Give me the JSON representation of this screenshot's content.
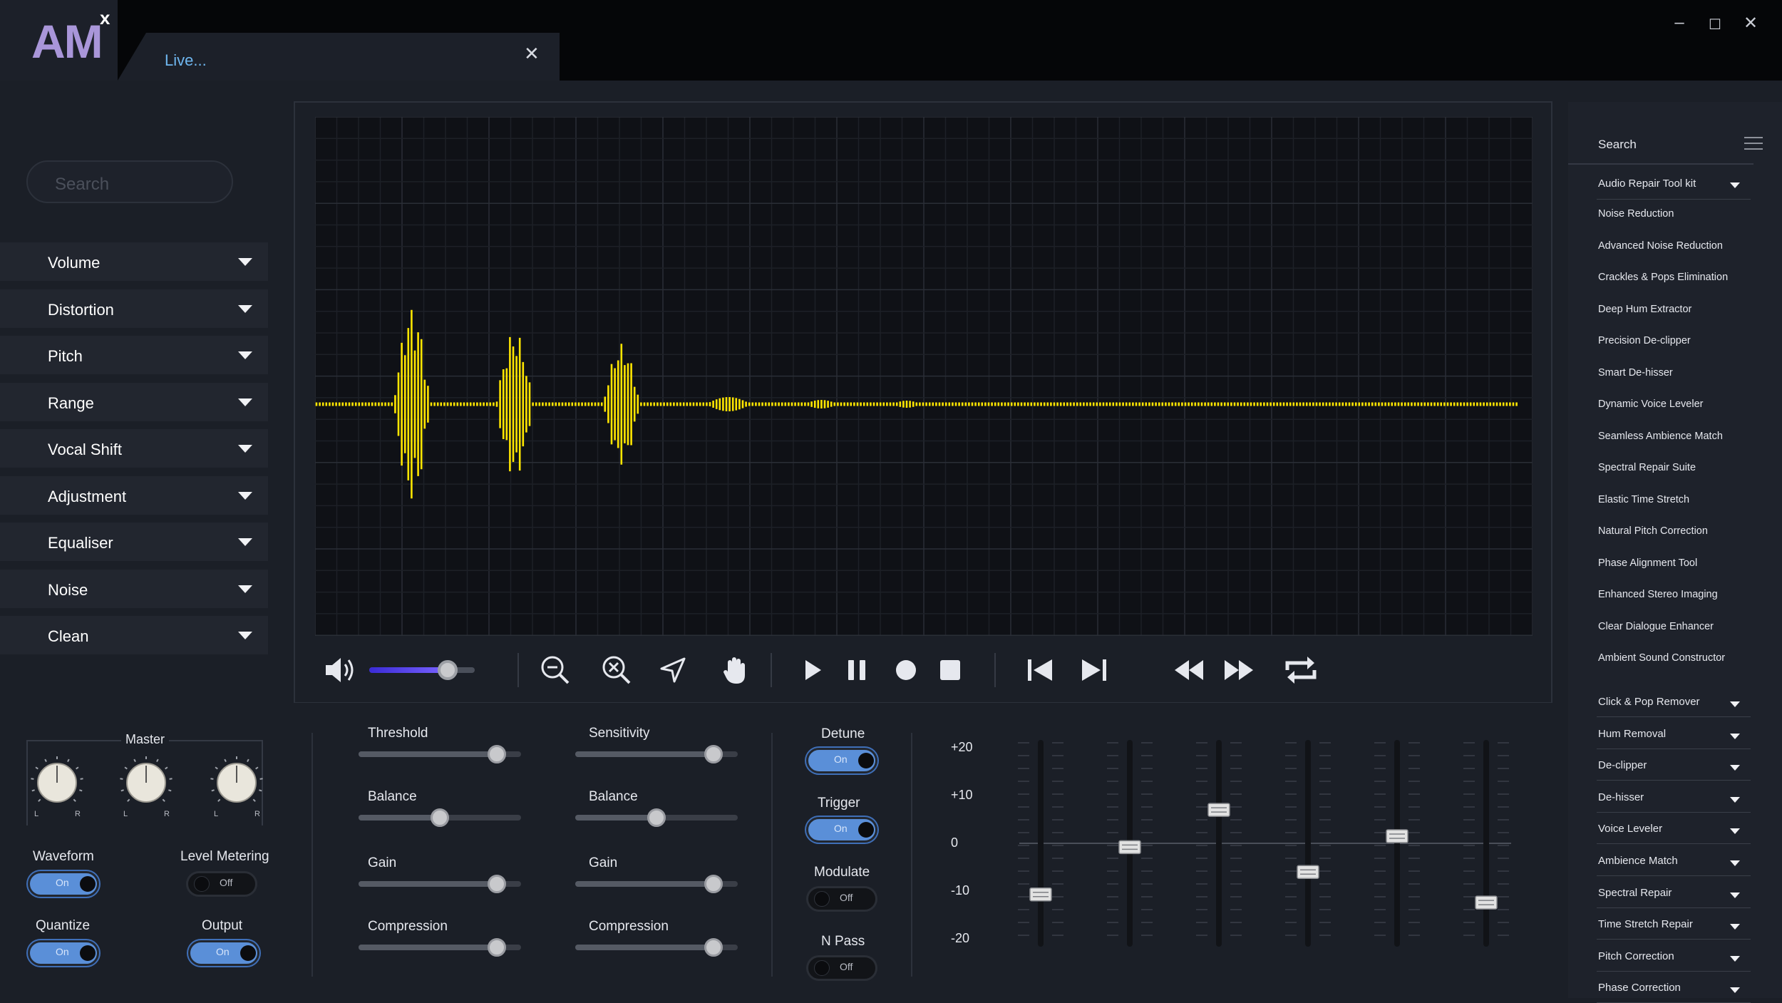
{
  "app": {
    "logo_main": "AM",
    "logo_sup": "x",
    "tab_title": "Live...",
    "window_controls": {
      "minimize": "–",
      "maximize": "☐",
      "close": "✕"
    }
  },
  "left_panel": {
    "search_placeholder": "Search",
    "menu": [
      "Volume",
      "Distortion",
      "Pitch",
      "Range",
      "Vocal Shift",
      "Adjustment",
      "Equaliser",
      "Noise",
      "Clean"
    ]
  },
  "colors": {
    "waveform": "#ffe600",
    "accent_blue": "#5a8fd8",
    "tab_text": "#6fb7f0",
    "logo": "#a996d9",
    "volume_gradient_start": "#3a2bd6",
    "volume_gradient_end": "#7a63ff"
  },
  "transport": {
    "volume_level": 0.74,
    "icons": [
      "speaker-icon",
      "zoom-out-icon",
      "zoom-fit-icon",
      "pointer-icon",
      "hand-icon",
      "play-icon",
      "pause-icon",
      "record-icon",
      "stop-icon",
      "skip-back-icon",
      "skip-forward-icon",
      "rewind-icon",
      "fast-forward-icon",
      "loop-icon"
    ]
  },
  "right_panel": {
    "search_label": "Search",
    "kit_header": "Audio Repair Tool kit",
    "kit_items": [
      "Noise Reduction",
      "Advanced Noise Reduction",
      "Crackles & Pops Elimination",
      "Deep Hum Extractor",
      "Precision De-clipper",
      "Smart De-hisser",
      "Dynamic Voice Leveler",
      "Seamless Ambience Match",
      "Spectral Repair Suite",
      "Elastic Time Stretch",
      "Natural Pitch Correction",
      "Phase Alignment Tool",
      "Enhanced Stereo Imaging",
      "Clear Dialogue Enhancer",
      "Ambient Sound Constructor"
    ],
    "sections": [
      "Click & Pop Remover",
      "Hum Removal",
      "De-clipper",
      "De-hisser",
      "Voice Leveler",
      "Ambience Match",
      "Spectral Repair",
      "Time Stretch Repair",
      "Pitch Correction",
      "Phase Correction"
    ]
  },
  "master": {
    "title": "Master",
    "knob_l": "L",
    "knob_r": "R",
    "toggles": [
      {
        "label": "Waveform",
        "state": "On"
      },
      {
        "label": "Level Metering",
        "state": "Off"
      },
      {
        "label": "Quantize",
        "state": "On"
      },
      {
        "label": "Output",
        "state": "On"
      }
    ]
  },
  "sliders_a": [
    {
      "label": "Threshold",
      "value": 0.85
    },
    {
      "label": "Balance",
      "value": 0.5
    },
    {
      "label": "Gain",
      "value": 0.85
    },
    {
      "label": "Compression",
      "value": 0.85
    }
  ],
  "sliders_b": [
    {
      "label": "Sensitivity",
      "value": 0.85
    },
    {
      "label": "Balance",
      "value": 0.5
    },
    {
      "label": "Gain",
      "value": 0.85
    },
    {
      "label": "Compression",
      "value": 0.85
    }
  ],
  "effects": [
    {
      "label": "Detune",
      "state": "On"
    },
    {
      "label": "Trigger",
      "state": "On"
    },
    {
      "label": "Modulate",
      "state": "Off"
    },
    {
      "label": "N Pass",
      "state": "Off"
    }
  ],
  "eq": {
    "scale": [
      "+20",
      "+10",
      "0",
      "-10",
      "-20"
    ],
    "bands_db": [
      -10.7,
      -0.8,
      7.0,
      -6.0,
      1.5,
      -12.4
    ]
  }
}
